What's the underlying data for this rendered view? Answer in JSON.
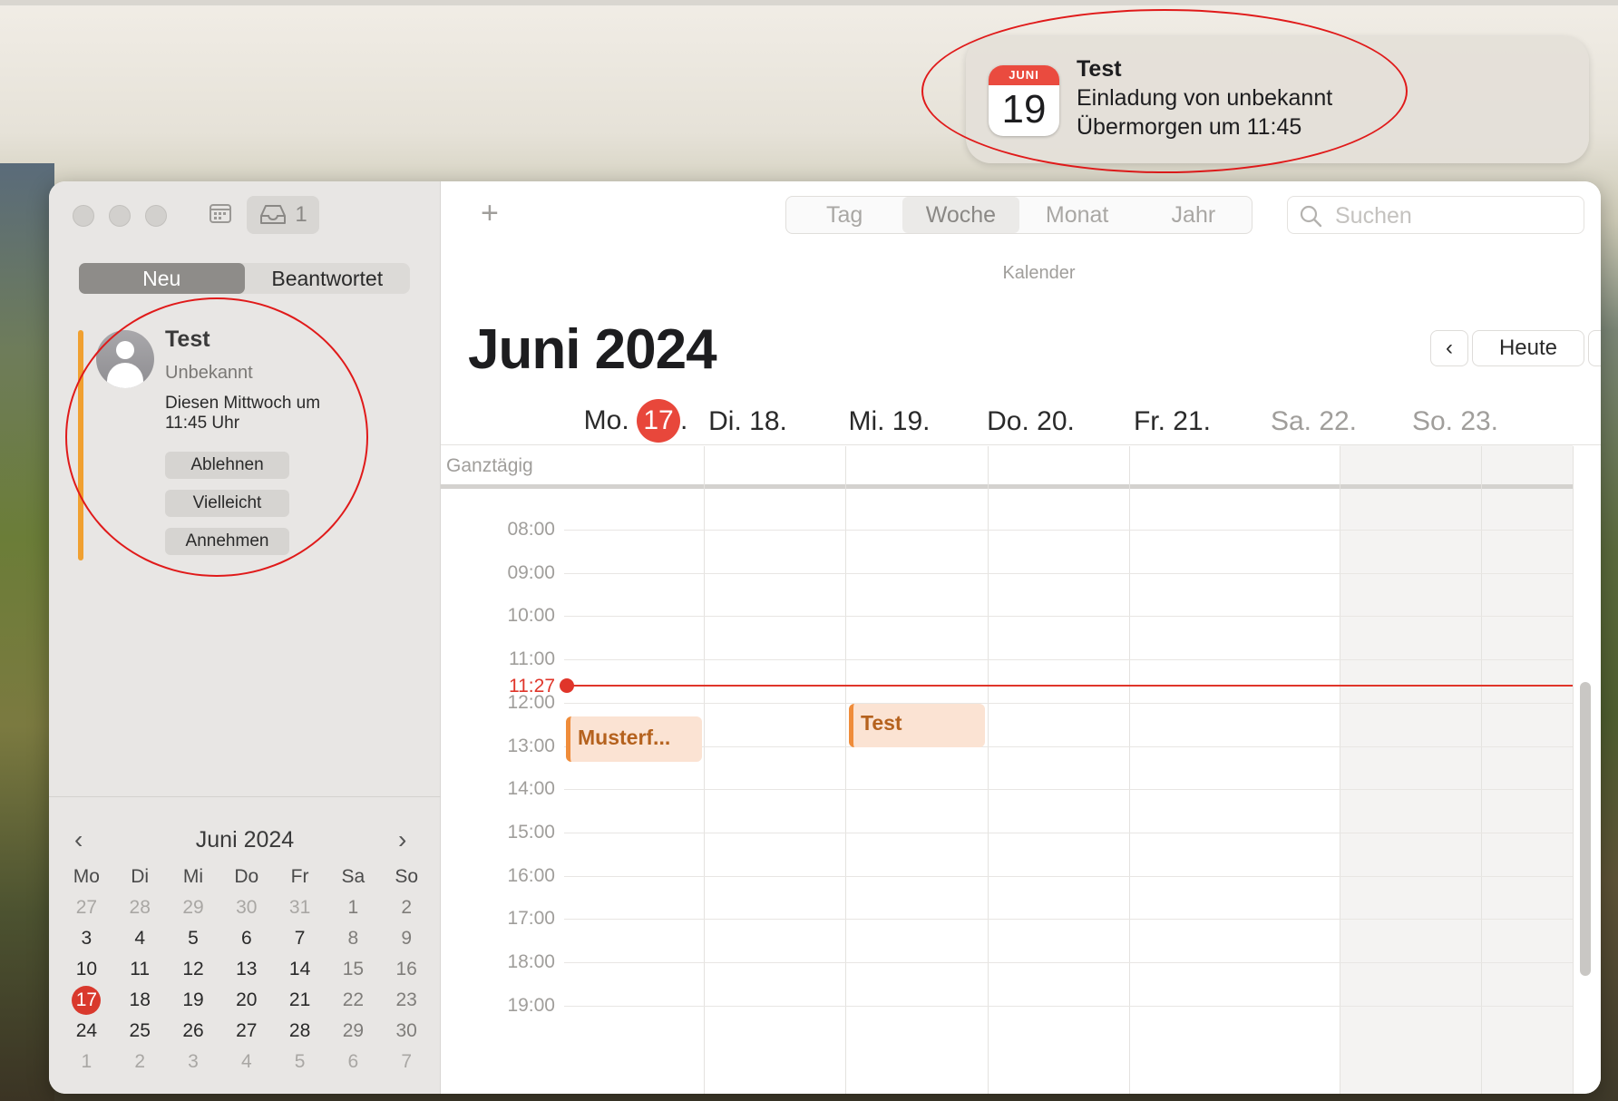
{
  "notification": {
    "icon_month": "JUNI",
    "icon_day": "19",
    "title": "Test",
    "line1": "Einladung von unbekannt",
    "line2": "Übermorgen um 11:45"
  },
  "toolbar": {
    "inbox_count": "1",
    "view_tabs": [
      "Tag",
      "Woche",
      "Monat",
      "Jahr"
    ],
    "active_view": "Woche",
    "search_placeholder": "Suchen",
    "calendar_label": "Kalender"
  },
  "sidebar": {
    "segments": [
      "Neu",
      "Beantwortet"
    ],
    "active_segment": "Neu",
    "invitation": {
      "title": "Test",
      "organizer": "Unbekannt",
      "when": "Diesen Mittwoch um 11:45 Uhr",
      "buttons": [
        "Ablehnen",
        "Vielleicht",
        "Annehmen"
      ]
    }
  },
  "mini_calendar": {
    "title": "Juni 2024",
    "weekdays": [
      "Mo",
      "Di",
      "Mi",
      "Do",
      "Fr",
      "Sa",
      "So"
    ],
    "weeks": [
      [
        "27",
        "28",
        "29",
        "30",
        "31",
        "1",
        "2"
      ],
      [
        "3",
        "4",
        "5",
        "6",
        "7",
        "8",
        "9"
      ],
      [
        "10",
        "11",
        "12",
        "13",
        "14",
        "15",
        "16"
      ],
      [
        "17",
        "18",
        "19",
        "20",
        "21",
        "22",
        "23"
      ],
      [
        "24",
        "25",
        "26",
        "27",
        "28",
        "29",
        "30"
      ],
      [
        "1",
        "2",
        "3",
        "4",
        "5",
        "6",
        "7"
      ]
    ],
    "today": "17"
  },
  "main": {
    "month_title": "Juni 2024",
    "today_button": "Heute",
    "days": [
      {
        "prefix": "Mo.",
        "num": "17",
        "suffix": ".",
        "today": true
      },
      {
        "label": "Di. 18."
      },
      {
        "label": "Mi. 19."
      },
      {
        "label": "Do. 20."
      },
      {
        "label": "Fr. 21."
      },
      {
        "label": "Sa. 22.",
        "weekend": true
      },
      {
        "label": "So. 23.",
        "weekend": true
      }
    ],
    "allday_label": "Ganztägig",
    "hours": [
      "08:00",
      "09:00",
      "10:00",
      "11:00",
      "12:00",
      "13:00",
      "14:00",
      "15:00",
      "16:00",
      "17:00",
      "18:00",
      "19:00"
    ],
    "current_time": "11:27",
    "events": [
      {
        "title": "Musterf...",
        "day": "Mo. 17.",
        "start": "12:05",
        "end": "13:00"
      },
      {
        "title": "Test",
        "day": "Mi. 19.",
        "start": "11:45",
        "end": "12:45"
      }
    ]
  },
  "colors": {
    "accent_red": "#e0352a",
    "event_orange": "#ef8c3a",
    "event_bg": "#fbe3d3",
    "annotation_red": "#e01a1a"
  }
}
